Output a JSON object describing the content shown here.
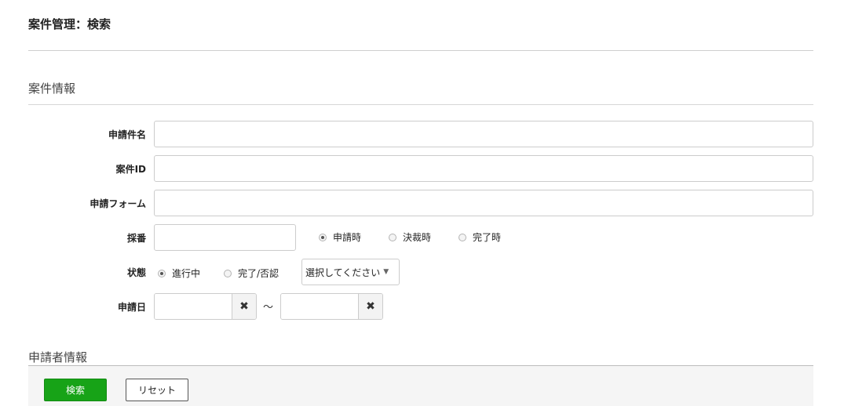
{
  "page": {
    "title": "案件管理：検索"
  },
  "sections": {
    "case_info": "案件情報",
    "applicant_info": "申請者情報"
  },
  "form": {
    "application_name": {
      "label": "申請件名",
      "value": ""
    },
    "case_id": {
      "label": "案件ID",
      "value": ""
    },
    "application_form": {
      "label": "申請フォーム",
      "value": ""
    },
    "numbering": {
      "label": "採番",
      "value": "",
      "options": [
        {
          "label": "申請時",
          "checked": true
        },
        {
          "label": "決裁時",
          "checked": false
        },
        {
          "label": "完了時",
          "checked": false
        }
      ]
    },
    "status": {
      "label": "状態",
      "options": [
        {
          "label": "進行中",
          "checked": true
        },
        {
          "label": "完了/否認",
          "checked": false
        }
      ],
      "select_value": "選択してください"
    },
    "application_date": {
      "label": "申請日",
      "from": "",
      "to": "",
      "separator": "～",
      "clear_icon": "close-icon"
    }
  },
  "footer": {
    "search_label": "検索",
    "reset_label": "リセット",
    "primary_color": "#17a317"
  }
}
